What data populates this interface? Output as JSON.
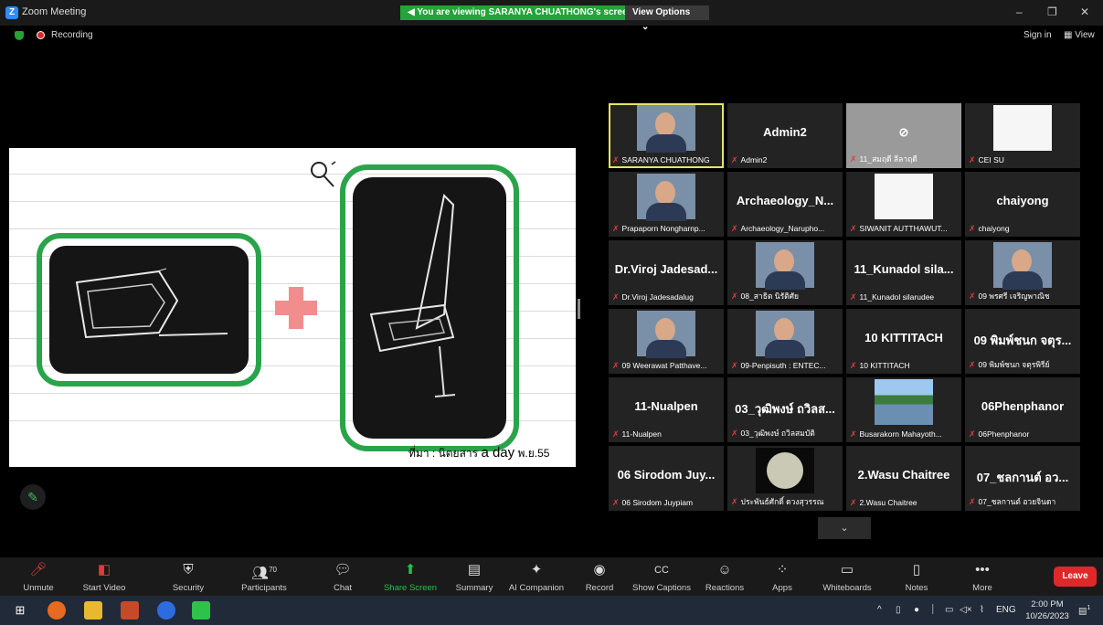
{
  "titlebar": {
    "logo": "Z",
    "title": "Zoom Meeting",
    "viewing": "You are viewing SARANYA CHUATHONG's screen",
    "view_options": "View Options",
    "minimize": "–",
    "restore": "❐",
    "close": "✕"
  },
  "statusbar": {
    "recording": "Recording",
    "sign_in": "Sign in",
    "view": "View"
  },
  "shared_content": {
    "source_prefix": "ที่มา : นิตยสาร",
    "source_title": "a day",
    "source_date": "พ.ย.55",
    "colors": {
      "frame": "#2aa44a",
      "plus": "#f28d8d"
    }
  },
  "participants": [
    {
      "big": "",
      "name": "SARANYA CHUATHONG",
      "video": "person",
      "active": true
    },
    {
      "big": "Admin2",
      "name": "Admin2"
    },
    {
      "big": "",
      "name": "11_สมฤดี ลีลาฤดี",
      "video": "off"
    },
    {
      "big": "",
      "name": "CEI SU",
      "video": "logo"
    },
    {
      "big": "",
      "name": "Prapaporn Nongharnp...",
      "video": "person"
    },
    {
      "big": "Archaeology_N...",
      "name": "Archaeology_Narupho..."
    },
    {
      "big": "",
      "name": "SIWANIT AUTTHAWUT...",
      "video": "logo"
    },
    {
      "big": "chaiyong",
      "name": "chaiyong"
    },
    {
      "big": "Dr.Viroj Jadesad...",
      "name": "Dr.Viroj Jadesadalug"
    },
    {
      "big": "",
      "name": "08_สาธิต นิรัติศัย",
      "video": "person"
    },
    {
      "big": "11_Kunadol sila...",
      "name": "11_Kunadol silarudee"
    },
    {
      "big": "",
      "name": "09 พรศรี เจริญพาณิช",
      "video": "person"
    },
    {
      "big": "",
      "name": "09 Weerawat Patthave...",
      "video": "person"
    },
    {
      "big": "",
      "name": "09-Penpisuth : ENTEC...",
      "video": "person"
    },
    {
      "big": "10 KITTITACH",
      "name": "10 KITTITACH"
    },
    {
      "big": "09 พิมพ์ชนก จตุร...",
      "name": "09 พิมพ์ชนก จตุรพิรีย์"
    },
    {
      "big": "11-Nualpen",
      "name": "11-Nualpen"
    },
    {
      "big": "03_วุฒิพงษ์ ถวิลส...",
      "name": "03_วุฒิพงษ์ ถวิลสมบัติ"
    },
    {
      "big": "",
      "name": "Busarakorn Mahayoth...",
      "video": "lake"
    },
    {
      "big": "06Phenphanor",
      "name": "06Phenphanor"
    },
    {
      "big": "06 Sirodom Juy...",
      "name": "06 Sirodom Juypiam"
    },
    {
      "big": "",
      "name": "ประพันธ์ศักดิ์ ดวงสุวรรณ",
      "video": "moon"
    },
    {
      "big": "2.Wasu Chaitree",
      "name": "2.Wasu Chaitree"
    },
    {
      "big": "07_ชลกานต์ อว...",
      "name": "07_ชลกานต์ อวยจินดา"
    }
  ],
  "toolbar": {
    "unmute": "Unmute",
    "start_video": "Start Video",
    "security": "Security",
    "participants": "Participants",
    "participants_count": "70",
    "chat": "Chat",
    "share_screen": "Share Screen",
    "summary": "Summary",
    "ai_companion": "AI Companion",
    "record": "Record",
    "show_captions": "Show Captions",
    "reactions": "Reactions",
    "apps": "Apps",
    "whiteboards": "Whiteboards",
    "notes": "Notes",
    "more": "More",
    "leave": "Leave"
  },
  "taskbar": {
    "lang": "ENG",
    "time": "2:00 PM",
    "date": "10/26/2023",
    "notifications": "1"
  }
}
